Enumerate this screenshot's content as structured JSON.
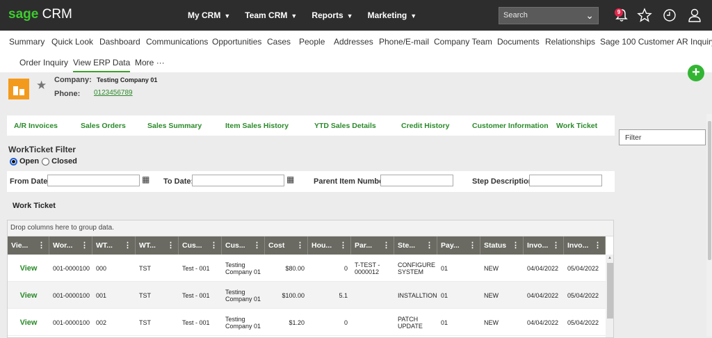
{
  "app": {
    "brand": "sage",
    "product": "CRM"
  },
  "topnav": [
    {
      "label": "My CRM"
    },
    {
      "label": "Team CRM"
    },
    {
      "label": "Reports"
    },
    {
      "label": "Marketing"
    }
  ],
  "search": {
    "placeholder": "Search"
  },
  "notifications": {
    "count": "9"
  },
  "tabs_row1": [
    "Summary",
    "Quick Look",
    "Dashboard",
    "Communications",
    "Opportunities",
    "Cases",
    "People",
    "Addresses",
    "Phone/E-mail",
    "Company Team",
    "Documents",
    "Relationships",
    "Sage 100 Customer",
    "AR Inquiry"
  ],
  "tabs_row2": [
    "Order Inquiry",
    "View ERP Data",
    "More"
  ],
  "tabs_row2_more_glyph": "···",
  "add_button": "+",
  "company": {
    "company_label": "Company:",
    "company_name": "Testing Company 01",
    "phone_label": "Phone:",
    "phone": "0123456789"
  },
  "erp_nav": [
    "A/R Invoices",
    "Sales Orders",
    "Sales Summary",
    "Item Sales History",
    "YTD Sales Details",
    "Credit History",
    "Customer Information",
    "Work Ticket"
  ],
  "filter": {
    "title": "WorkTicket Filter",
    "radio_open": "Open",
    "radio_closed": "Closed",
    "from_date_label": "From Date:",
    "to_date_label": "To Date:",
    "parent_item_label": "Parent Item Number:",
    "step_desc_label": "Step Description:"
  },
  "work_ticket": {
    "title": "Work Ticket",
    "drop_hint": "Drop columns here to group data.",
    "columns": [
      "Vie...",
      "Wor...",
      "WT...",
      "WT...",
      "Cus...",
      "Cus...",
      "Cost",
      "Hou...",
      "Par...",
      "Ste...",
      "Pay...",
      "Status",
      "Invo...",
      "Invo..."
    ],
    "kebab_glyph": "⋮",
    "rows": [
      [
        "View",
        "001-0000100",
        "000",
        "TST",
        "Test - 001",
        "Testing Company 01",
        "$80.00",
        "0",
        "T-TEST - 0000012",
        "CONFIGURE SYSTEM",
        "01",
        "NEW",
        "04/04/2022",
        "05/04/2022"
      ],
      [
        "View",
        "001-0000100",
        "001",
        "TST",
        "Test - 001",
        "Testing Company 01",
        "$100.00",
        "5.1",
        "",
        "INSTALLTION",
        "01",
        "NEW",
        "04/04/2022",
        "05/04/2022"
      ],
      [
        "View",
        "001-0000100",
        "002",
        "TST",
        "Test - 001",
        "Testing Company 01",
        "$1.20",
        "0",
        "",
        "PATCH UPDATE",
        "01",
        "NEW",
        "04/04/2022",
        "05/04/2022"
      ]
    ]
  },
  "side_filter": {
    "label": "Filter"
  },
  "colors": {
    "brand_green": "#3ecb2f",
    "link_green": "#2b8a2b",
    "topbar": "#2d2d2d",
    "grid_header": "#6a6a62",
    "company_icon": "#f39a1c",
    "add_button": "#33b534"
  }
}
